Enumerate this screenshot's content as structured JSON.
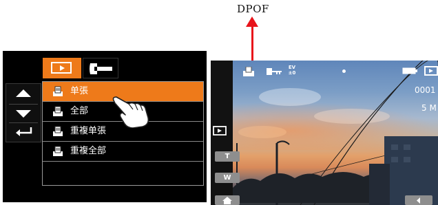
{
  "annotation": {
    "label": "DPOF"
  },
  "menu": {
    "tabs": [
      {
        "name": "playback",
        "icon": "play-icon"
      },
      {
        "name": "setup",
        "icon": "wrench-icon"
      }
    ],
    "items": [
      {
        "label": "单張",
        "icon": "print-icon"
      },
      {
        "label": "全部",
        "icon": "print-icon"
      },
      {
        "label": "重複单張",
        "icon": "print-icon"
      },
      {
        "label": "重複全部",
        "icon": "print-icon"
      }
    ],
    "selected_index": 0,
    "nav": [
      "up-arrow-icon",
      "down-arrow-icon",
      "return-icon"
    ]
  },
  "preview": {
    "file_number": "0001",
    "resolution": "5 M",
    "zoom_tele": "T",
    "zoom_wide": "W",
    "icons": [
      "dpof-icon",
      "protect-icon",
      "ev-icon",
      "dot-icon",
      "battery-icon",
      "play-mode-icon",
      "home-icon",
      "prev-icon"
    ]
  },
  "colors": {
    "accent": "#ee7a1a",
    "arrow": "#e8141b"
  }
}
